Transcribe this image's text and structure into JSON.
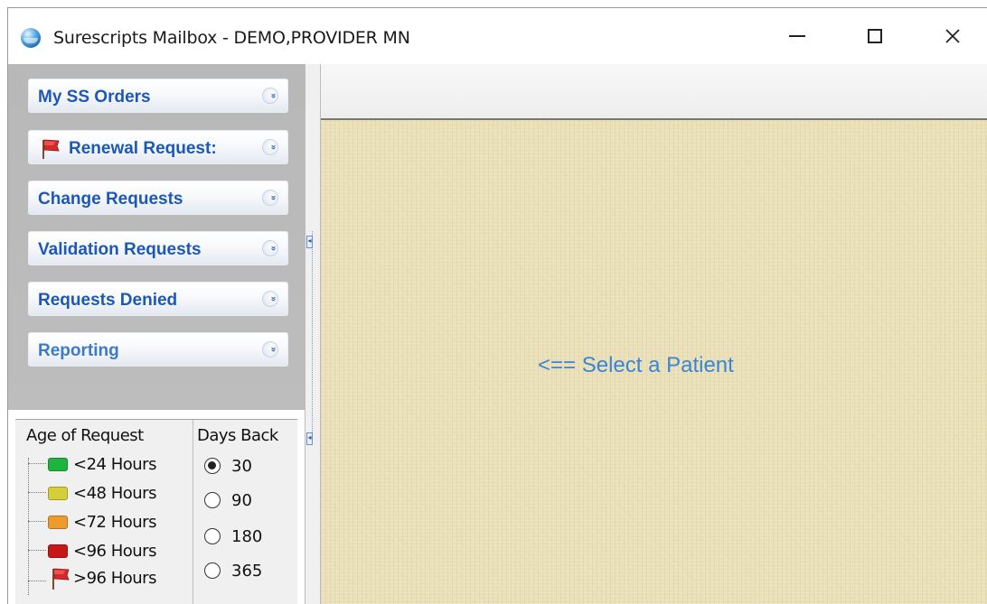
{
  "window": {
    "title": "Surescripts Mailbox - DEMO,PROVIDER MN",
    "minimize_glyph": "—",
    "maximize_glyph": "☐",
    "close_glyph": "✕"
  },
  "sidebar": {
    "items": [
      {
        "label": "My SS Orders",
        "icon": "none"
      },
      {
        "label": "Renewal Request:",
        "icon": "red-flag-icon"
      },
      {
        "label": "Change Requests",
        "icon": "none"
      },
      {
        "label": "Validation Requests",
        "icon": "none"
      },
      {
        "label": "Requests Denied",
        "icon": "none"
      },
      {
        "label": "Reporting",
        "icon": "none"
      }
    ],
    "chevron_glyph": "»"
  },
  "legend": {
    "age_heading": "Age of Request",
    "days_heading": "Days Back",
    "ages": [
      {
        "label": "<24 Hours",
        "color": "#1fb340"
      },
      {
        "label": "<48 Hours",
        "color": "#d4cf38"
      },
      {
        "label": "<72 Hours",
        "color": "#ef9a2c"
      },
      {
        "label": "<96 Hours",
        "color": "#c81616"
      },
      {
        "label": ">96 Hours",
        "color": "flag"
      }
    ],
    "days": [
      {
        "label": "30",
        "checked": true
      },
      {
        "label": "90",
        "checked": false
      },
      {
        "label": "180",
        "checked": false
      },
      {
        "label": "365",
        "checked": false
      }
    ]
  },
  "content": {
    "message": "<== Select a Patient"
  }
}
